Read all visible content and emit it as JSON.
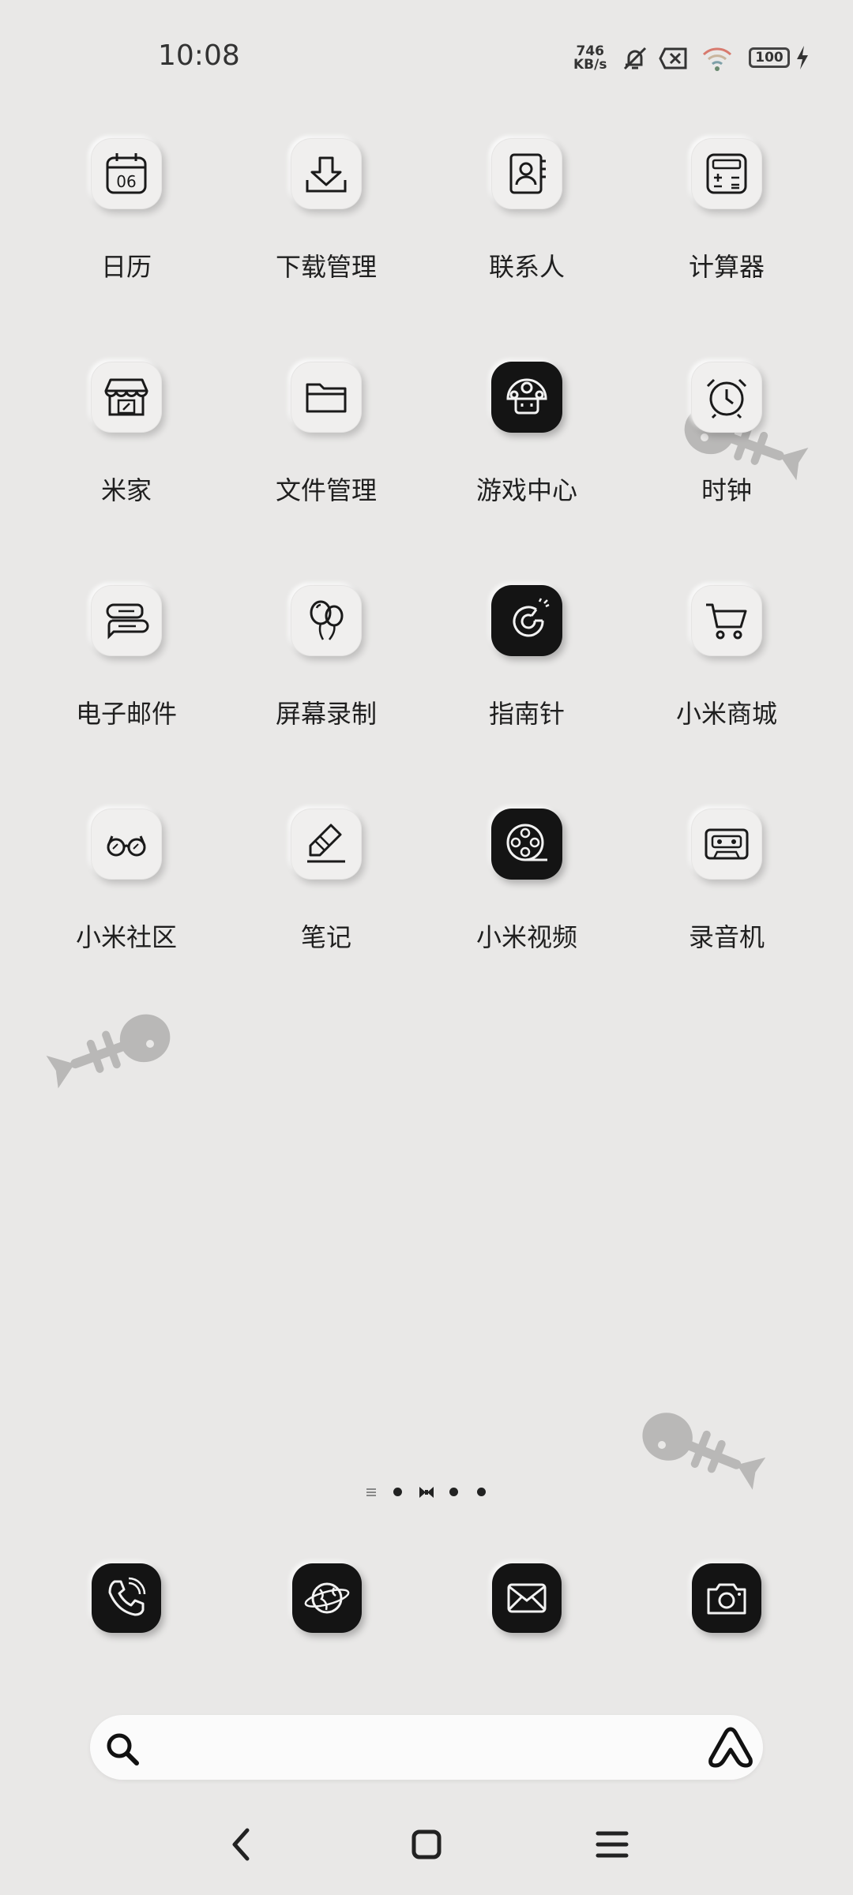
{
  "status_bar": {
    "time": "10:08",
    "net_speed_value": "746",
    "net_speed_unit": "KB/s",
    "battery": "100"
  },
  "apps": [
    {
      "label": "日历",
      "icon": "calendar-icon",
      "icon_text": "06"
    },
    {
      "label": "下载管理",
      "icon": "download-icon"
    },
    {
      "label": "联系人",
      "icon": "contacts-icon"
    },
    {
      "label": "计算器",
      "icon": "calculator-icon"
    },
    {
      "label": "米家",
      "icon": "store-icon"
    },
    {
      "label": "文件管理",
      "icon": "folder-icon"
    },
    {
      "label": "游戏中心",
      "icon": "mushroom-icon"
    },
    {
      "label": "时钟",
      "icon": "alarm-clock-icon"
    },
    {
      "label": "电子邮件",
      "icon": "chat-bubble-icon"
    },
    {
      "label": "屏幕录制",
      "icon": "balloons-icon"
    },
    {
      "label": "指南针",
      "icon": "magnet-icon"
    },
    {
      "label": "小米商城",
      "icon": "shopping-cart-icon"
    },
    {
      "label": "小米社区",
      "icon": "glasses-icon"
    },
    {
      "label": "笔记",
      "icon": "pencil-icon"
    },
    {
      "label": "小米视频",
      "icon": "film-reel-icon"
    },
    {
      "label": "录音机",
      "icon": "cassette-icon"
    }
  ],
  "pager": {
    "pages": 5,
    "current": 2
  },
  "dock": [
    {
      "icon": "phone-icon"
    },
    {
      "icon": "globe-icon"
    },
    {
      "icon": "mail-icon"
    },
    {
      "icon": "camera-icon"
    }
  ],
  "search": {
    "placeholder": ""
  },
  "colors": {
    "background": "#e9e8e7",
    "tile_light": "#f0efee",
    "tile_dark": "#141414",
    "fish": "#b9b8b7"
  }
}
